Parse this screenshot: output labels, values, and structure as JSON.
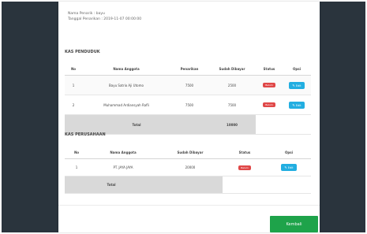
{
  "meta": {
    "nama_penarik": "Nama Penarik : bayu",
    "tanggal": "Tanggal Penarikan : 2019-11-07 00:00:00"
  },
  "kas_penduduk": {
    "title": "KAS PENDUDUK",
    "headers": [
      "No",
      "Nama Anggota",
      "Penarikan",
      "Sudah Dibayar",
      "Status",
      "Opsi"
    ],
    "rows": [
      {
        "no": "1",
        "nama": "Bayu Satrio Aji Utomo",
        "penarikan": "7500",
        "sudah": "2500",
        "status": "Belum",
        "opsi": "Edit"
      },
      {
        "no": "2",
        "nama": "Muhammad Ardiansyah Rafli",
        "penarikan": "7500",
        "sudah": "7500",
        "status": "Belum",
        "opsi": "Edit"
      }
    ],
    "total_label": "Total",
    "total_value": "10000"
  },
  "kas_perusahaan": {
    "title": "KAS PERUSAHAAN",
    "headers": [
      "No",
      "Nama Anggota",
      "Sudah Dibayar",
      "Status",
      "Opsi"
    ],
    "rows": [
      {
        "no": "1",
        "nama": "PT. JAYA JAYA",
        "sudah": "20000",
        "status": "Belum",
        "opsi": "Edit"
      }
    ],
    "total_label": "Total"
  },
  "footer": {
    "kembali_label": "Kembali"
  },
  "colors": {
    "badge": "#e04848",
    "edit": "#22aee1",
    "kembali": "#1ea34a",
    "total_row": "#d9d9d9"
  },
  "icons": {
    "edit": "pencil-icon"
  }
}
